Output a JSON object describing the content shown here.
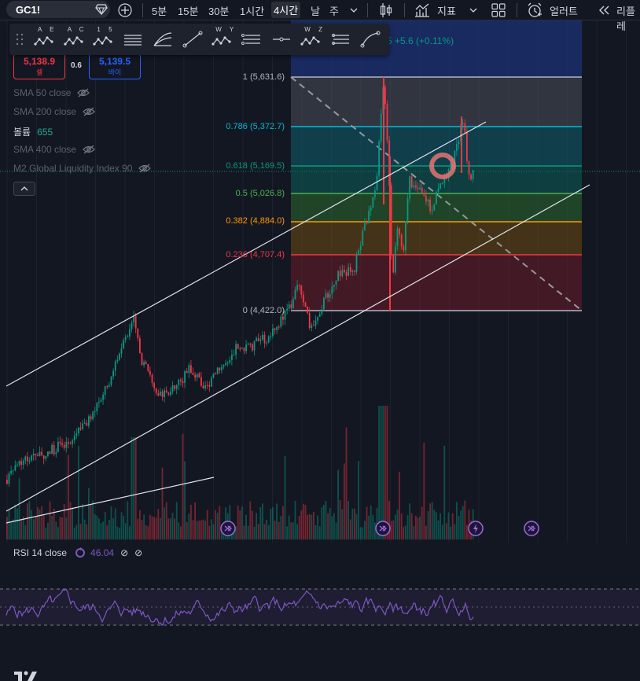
{
  "toolbar": {
    "symbol": "GC1!",
    "intervals": [
      "5분",
      "15분",
      "30분",
      "1시간",
      "4시간"
    ],
    "selected_interval": "4시간",
    "range_day": "날",
    "range_week": "주",
    "indicators_label": "지표",
    "alert_label": "얼러트",
    "replay_label": "리플레"
  },
  "drawing_tools": [
    {
      "name": "abcd-pattern-tool",
      "caption": "A E"
    },
    {
      "name": "abcd-pattern-2-tool",
      "caption": "A C"
    },
    {
      "name": "elliott-wave-tool",
      "caption": "1 5"
    },
    {
      "name": "horizontal-lines-tool",
      "caption": ""
    },
    {
      "name": "fib-fan-tool",
      "caption": ""
    },
    {
      "name": "trend-line-tool",
      "caption": ""
    },
    {
      "name": "wxy-wave-tool",
      "caption": "W Y"
    },
    {
      "name": "fib-retracement-tool",
      "caption": ""
    },
    {
      "name": "horizontal-ray-tool",
      "caption": ""
    },
    {
      "name": "wxyz-wave-tool",
      "caption": "W Z"
    },
    {
      "name": "pitchfork-tool",
      "caption": ""
    },
    {
      "name": "curve-tool",
      "caption": ""
    }
  ],
  "quote": {
    "sell_price": "5,138.9",
    "sell_label": "셀",
    "spread": "0.6",
    "buy_price": "5,139.5",
    "buy_label": "바이",
    "change_text": "5  +5.6 (+0.11%)"
  },
  "indicators": [
    {
      "label": "SMA 50 close",
      "hidden": true
    },
    {
      "label": "SMA 200 close",
      "hidden": true
    },
    {
      "label": "볼륨",
      "value": "655",
      "hidden": false
    },
    {
      "label": "SMA 400 close",
      "hidden": true
    },
    {
      "label": "M2 Global Liquidity Index 90",
      "hidden": true
    }
  ],
  "fib_levels": [
    {
      "label": "1 (5,631.6)",
      "color": "#b2b5be"
    },
    {
      "label": "0.786 (5,372.7)",
      "color": "#00bcd4"
    },
    {
      "label": "0.618 (5,169.5)",
      "color": "#089981"
    },
    {
      "label": "0.5 (5,026.8)",
      "color": "#4caf50"
    },
    {
      "label": "0.382 (4,884.0)",
      "color": "#ff9800"
    },
    {
      "label": "0.236 (4,707.4)",
      "color": "#f23645"
    },
    {
      "label": "0 (4,422.0)",
      "color": "#b2b5be"
    }
  ],
  "rsi": {
    "label": "RSI 14 close",
    "value": "46.04"
  },
  "colors": {
    "up": "#089981",
    "down": "#f23645",
    "rsi_line": "#7e57c2",
    "accent": "#2962ff"
  }
}
